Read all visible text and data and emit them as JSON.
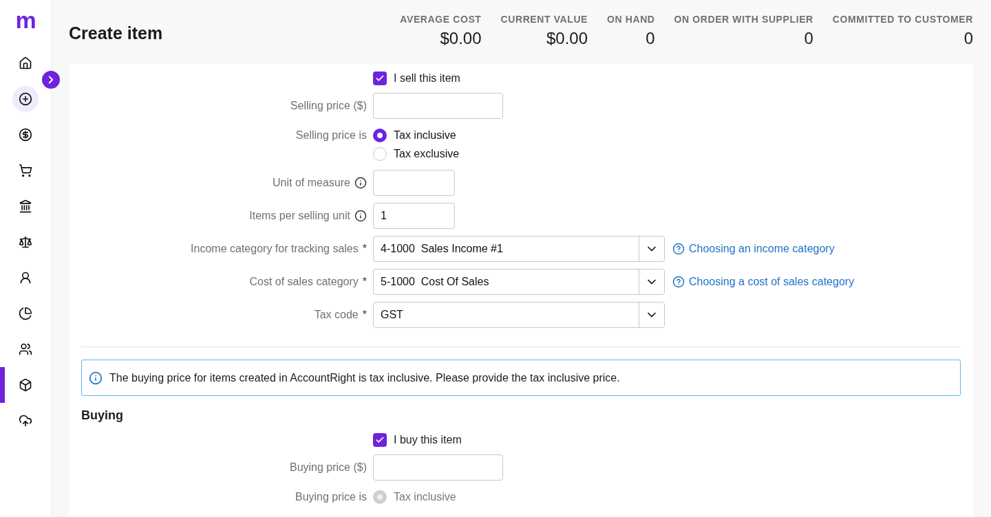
{
  "logo": "m",
  "sidebar": {
    "items": [
      {
        "selected": false,
        "highlighted": false
      },
      {
        "selected": false,
        "highlighted": true
      },
      {
        "selected": false,
        "highlighted": false
      },
      {
        "selected": false,
        "highlighted": false
      },
      {
        "selected": false,
        "highlighted": false
      },
      {
        "selected": false,
        "highlighted": false
      },
      {
        "selected": false,
        "highlighted": false
      },
      {
        "selected": false,
        "highlighted": false
      },
      {
        "selected": false,
        "highlighted": false
      },
      {
        "selected": true,
        "highlighted": false
      },
      {
        "selected": false,
        "highlighted": false
      }
    ]
  },
  "title": "Create item",
  "stats": [
    {
      "label": "AVERAGE COST",
      "value": "$0.00"
    },
    {
      "label": "CURRENT VALUE",
      "value": "$0.00"
    },
    {
      "label": "ON HAND",
      "value": "0"
    },
    {
      "label": "ON ORDER WITH SUPPLIER",
      "value": "0"
    },
    {
      "label": "COMMITTED TO CUSTOMER",
      "value": "0"
    }
  ],
  "selling": [
    {
      "kind": "checkbox",
      "text": "I sell this item",
      "checked": true
    },
    {
      "kind": "text",
      "label": "Selling price ($)"
    },
    {
      "kind": "radio",
      "label": "Selling price is",
      "disabled": false,
      "options": [
        {
          "text": "Tax inclusive",
          "selected": true
        },
        {
          "text": "Tax exclusive",
          "selected": false
        }
      ]
    },
    {
      "kind": "text",
      "label": "Unit of measure",
      "info": true
    },
    {
      "kind": "text",
      "label": "Items per selling unit",
      "info": true,
      "value": "1"
    },
    {
      "kind": "select",
      "label": "Income category for tracking sales",
      "required": "*",
      "value": "4-1000  Sales Income #1",
      "link": "Choosing an income category"
    },
    {
      "kind": "select",
      "label": "Cost of sales category",
      "required": "*",
      "value": "5-1000  Cost Of Sales",
      "link": "Choosing a cost of sales category"
    },
    {
      "kind": "select",
      "label": "Tax code",
      "required": "*",
      "value": "GST"
    }
  ],
  "notice": "The buying price for items created in AccountRight is tax inclusive. Please provide the tax inclusive price.",
  "buying_heading": "Buying",
  "buying": [
    {
      "kind": "checkbox",
      "text": "I buy this item",
      "checked": true
    },
    {
      "kind": "text",
      "label": "Buying price ($)"
    },
    {
      "kind": "radio",
      "label": "Buying price is",
      "disabled": true,
      "options": [
        {
          "text": "Tax inclusive",
          "selected": true
        }
      ]
    }
  ]
}
